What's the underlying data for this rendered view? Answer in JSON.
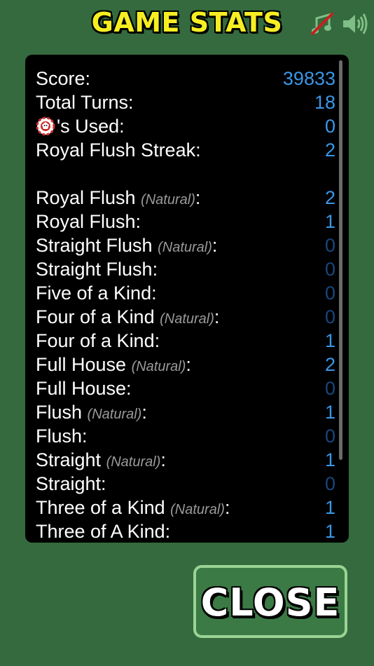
{
  "header": {
    "title": "GAME STATS"
  },
  "icons": {
    "music": "music-muted-icon",
    "sound": "speaker-on-icon",
    "joker": "joker-token-icon"
  },
  "stats": {
    "score_label": "Score:",
    "score": "39833",
    "turns_label": "Total Turns:",
    "turns": "18",
    "jokers_label": "'s Used:",
    "jokers": "0",
    "streak_label": "Royal Flush Streak:",
    "streak": "2"
  },
  "natural_tag": "(Natural)",
  "hands": [
    {
      "label": "Royal Flush",
      "natural": true,
      "value": "2"
    },
    {
      "label": "Royal Flush:",
      "natural": false,
      "value": "1"
    },
    {
      "label": "Straight Flush",
      "natural": true,
      "value": "0"
    },
    {
      "label": "Straight Flush:",
      "natural": false,
      "value": "0"
    },
    {
      "label": "Five of a Kind:",
      "natural": false,
      "value": "0"
    },
    {
      "label": "Four of a Kind",
      "natural": true,
      "value": "0"
    },
    {
      "label": "Four of a Kind:",
      "natural": false,
      "value": "1"
    },
    {
      "label": "Full House",
      "natural": true,
      "value": "2"
    },
    {
      "label": "Full House:",
      "natural": false,
      "value": "0"
    },
    {
      "label": "Flush",
      "natural": true,
      "value": "1"
    },
    {
      "label": "Flush:",
      "natural": false,
      "value": "0"
    },
    {
      "label": "Straight",
      "natural": true,
      "value": "1"
    },
    {
      "label": "Straight:",
      "natural": false,
      "value": "0"
    },
    {
      "label": "Three of a Kind",
      "natural": true,
      "value": "1"
    },
    {
      "label": "Three of A Kind:",
      "natural": false,
      "value": "1"
    }
  ],
  "footer": {
    "close_label": "CLOSE"
  },
  "colors": {
    "background": "#346a3e",
    "title": "#f6ee22",
    "value": "#3a97e8",
    "value_zero": "#16477d"
  }
}
